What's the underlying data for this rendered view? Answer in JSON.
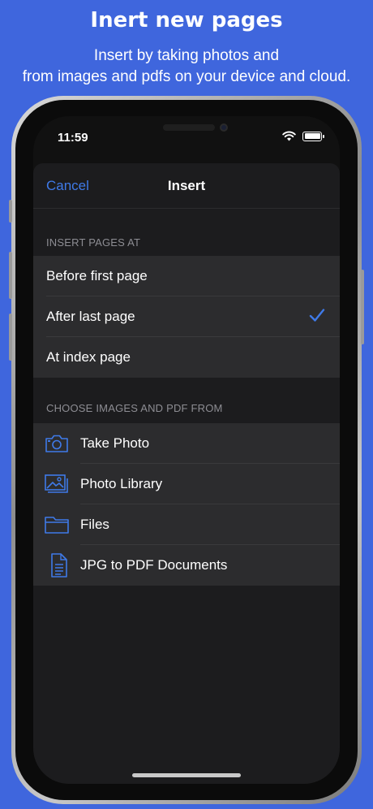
{
  "promo": {
    "title": "Inert new pages",
    "subtitle_line1": "Insert by taking photos and",
    "subtitle_line2": "from images and pdfs on your device and cloud."
  },
  "status_bar": {
    "time": "11:59"
  },
  "nav": {
    "cancel_label": "Cancel",
    "title": "Insert"
  },
  "insert_section": {
    "header": "INSERT PAGES AT",
    "options": [
      {
        "label": "Before first page",
        "selected": false
      },
      {
        "label": "After last page",
        "selected": true
      },
      {
        "label": "At index page",
        "selected": false
      }
    ]
  },
  "source_section": {
    "header": "CHOOSE IMAGES AND PDF FROM",
    "items": [
      {
        "label": "Take Photo",
        "icon": "camera-icon"
      },
      {
        "label": "Photo Library",
        "icon": "photo-library-icon"
      },
      {
        "label": "Files",
        "icon": "folder-icon"
      },
      {
        "label": "JPG to PDF Documents",
        "icon": "document-icon"
      }
    ]
  },
  "colors": {
    "background": "#3f66dd",
    "accent": "#3f7ae8",
    "sheet": "#1c1c1e",
    "row": "#2c2c2e"
  }
}
